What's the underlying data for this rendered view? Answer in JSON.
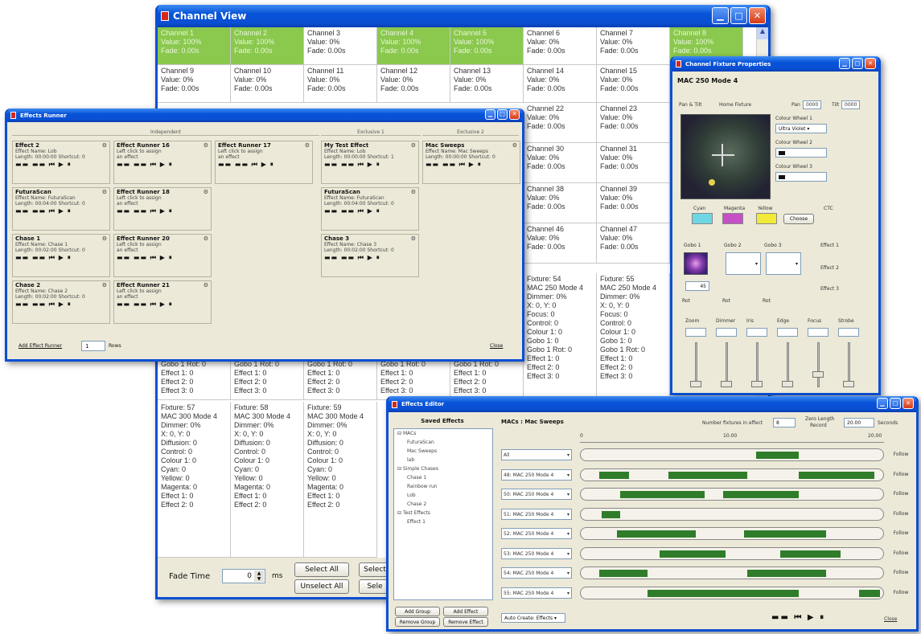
{
  "channel_view": {
    "title": "Channel View",
    "rows": [
      [
        {
          "l1": "Channel 1",
          "l2": "Value: 100%",
          "l3": "Fade: 0.00s",
          "on": true
        },
        {
          "l1": "Channel 2",
          "l2": "Value: 100%",
          "l3": "Fade: 0.00s",
          "on": true
        },
        {
          "l1": "Channel 3",
          "l2": "Value: 0%",
          "l3": "Fade: 0.00s",
          "on": false
        },
        {
          "l1": "Channel 4",
          "l2": "Value: 100%",
          "l3": "Fade: 0.00s",
          "on": true
        },
        {
          "l1": "Channel 5",
          "l2": "Value: 100%",
          "l3": "Fade: 0.00s",
          "on": true
        },
        {
          "l1": "Channel 6",
          "l2": "Value: 0%",
          "l3": "Fade: 0.00s",
          "on": false
        },
        {
          "l1": "Channel 7",
          "l2": "Value: 0%",
          "l3": "Fade: 0.00s",
          "on": false
        },
        {
          "l1": "Channel 8",
          "l2": "Value: 100%",
          "l3": "Fade: 0.00s",
          "on": true
        }
      ],
      [
        {
          "l1": "Channel 9",
          "l2": "Value: 0%",
          "l3": "Fade: 0.00s",
          "on": false
        },
        {
          "l1": "Channel 10",
          "l2": "Value: 0%",
          "l3": "Fade: 0.00s",
          "on": false
        },
        {
          "l1": "Channel 11",
          "l2": "Value: 0%",
          "l3": "Fade: 0.00s",
          "on": false
        },
        {
          "l1": "Channel 12",
          "l2": "Value: 0%",
          "l3": "Fade: 0.00s",
          "on": false
        },
        {
          "l1": "Channel 13",
          "l2": "Value: 0%",
          "l3": "Fade: 0.00s",
          "on": false
        },
        {
          "l1": "Channel 14",
          "l2": "Value: 0%",
          "l3": "Fade: 0.00s",
          "on": false
        },
        {
          "l1": "Channel 15",
          "l2": "Value: 0%",
          "l3": "Fade: 0.00s",
          "on": false
        }
      ]
    ],
    "right_cells": [
      {
        "l1": "Channel 22",
        "l2": "Value: 0%",
        "l3": "Fade: 0.00s"
      },
      {
        "l1": "Channel 23",
        "l2": "Value: 0%",
        "l3": "Fade: 0.00s"
      },
      {
        "l1": "Channel 30",
        "l2": "Value: 0%",
        "l3": "Fade: 0.00s"
      },
      {
        "l1": "Channel 31",
        "l2": "Value: 0%",
        "l3": "Fade: 0.00s"
      },
      {
        "l1": "Channel 38",
        "l2": "Value: 0%",
        "l3": "Fade: 0.00s"
      },
      {
        "l1": "Channel 39",
        "l2": "Value: 0%",
        "l3": "Fade: 0.00s"
      },
      {
        "l1": "Channel 46",
        "l2": "Value: 0%",
        "l3": "Fade: 0.00s"
      },
      {
        "l1": "Channel 47",
        "l2": "Value: 0%",
        "l3": "Fade: 0.00s"
      }
    ],
    "fixture_cells": [
      {
        "text": "Fixture: 54\nMAC 250 Mode 4\nDimmer: 0%\nX: 0, Y: 0\nFocus: 0\nControl: 0\nColour 1: 0\nGobo 1: 0\nGobo 1 Rot: 0\nEffect 1: 0\nEffect 2: 0\nEffect 3: 0"
      },
      {
        "text": "Fixture: 55\nMAC 250 Mode 4\nDimmer: 0%\nX: 0, Y: 0\nFocus: 0\nControl: 0\nColour 1: 0\nGobo 1: 0\nGobo 1 Rot: 0\nEffect 1: 0\nEffect 2: 0\nEffect 3: 0"
      }
    ],
    "effect_cells": [
      {
        "text": "Gobo 1 Rot: 0\nEffect 1: 0\nEffect 2: 0\nEffect 3: 0"
      },
      {
        "text": "Gobo 1 Rot: 0\nEffect 1: 0\nEffect 2: 0\nEffect 3: 0"
      },
      {
        "text": "Gobo 1 Rot: 0\nEffect 1: 0\nEffect 2: 0\nEffect 3: 0"
      },
      {
        "text": "Gobo 1 Rot: 0\nEffect 1: 0\nEffect 2: 0\nEffect 3: 0"
      },
      {
        "text": "Gobo 1 Rot: 0\nEffect 1: 0\nEffect 2: 0\nEffect 3: 0"
      }
    ],
    "mac300_cells": [
      {
        "text": "Fixture: 57\nMAC 300 Mode 4\nDimmer: 0%\nX: 0, Y: 0\nDiffusion: 0\nControl: 0\nColour 1: 0\nCyan: 0\nYellow: 0\nMagenta: 0\nEffect 1: 0\nEffect 2: 0"
      },
      {
        "text": "Fixture: 58\nMAC 300 Mode 4\nDimmer: 0%\nX: 0, Y: 0\nDiffusion: 0\nControl: 0\nColour 1: 0\nCyan: 0\nYellow: 0\nMagenta: 0\nEffect 1: 0\nEffect 2: 0"
      },
      {
        "text": "Fixture: 59\nMAC 300 Mode 4\nDimmer: 0%\nX: 0, Y: 0\nDiffusion: 0\nControl: 0\nColour 1: 0\nCyan: 0\nYellow: 0\nMagenta: 0\nEffect 1: 0\nEffect 2: 0"
      }
    ],
    "fade_label": "Fade Time",
    "fade_value": "0",
    "fade_unit": "ms",
    "select_all": "Select All",
    "unselect_all": "Unselect All",
    "select_clip": "Select",
    "select_clip2": "Sele"
  },
  "effects_runner": {
    "title": "Effects Runner",
    "headers": [
      "Independent",
      "Exclusive 1",
      "Exclusive 2"
    ],
    "effects": [
      {
        "name": "Effect 2",
        "d1": "Effect Name: Lob",
        "d2": "Length: 00:00:00 Shortcut: 0"
      },
      {
        "name": "Effect Runner 16",
        "d1": "Left click to assign",
        "d2": "an effect"
      },
      {
        "name": "Effect Runner 17",
        "d1": "Left click to assign",
        "d2": "an effect"
      },
      {
        "name": "My Test Effect",
        "d1": "Effect Name: Lob",
        "d2": "Length: 00:00:00 Shortcut: 1"
      },
      {
        "name": "Mac Sweeps",
        "d1": "Effect Name: Mac Sweeps",
        "d2": "Length: 00:00:00 Shortcut: 0"
      },
      {
        "name": "FuturaScan",
        "d1": "Effect Name: FuturaScan",
        "d2": "Length: 00:04:00 Shortcut: 0"
      },
      {
        "name": "Effect Runner 18",
        "d1": "Left click to assign",
        "d2": "an effect"
      },
      {
        "name": "FuturaScan",
        "d1": "Effect Name: FuturaScan",
        "d2": "Length: 00:04:00 Shortcut: 0"
      },
      {
        "name": "Chase 1",
        "d1": "Effect Name: Chase 1",
        "d2": "Length: 00:02:00 Shortcut: 0"
      },
      {
        "name": "Effect Runner 20",
        "d1": "Left click to assign",
        "d2": "an effect"
      },
      {
        "name": "Chase 3",
        "d1": "Effect Name: Chase 3",
        "d2": "Length: 00:02:00 Shortcut: 0"
      },
      {
        "name": "Chase 2",
        "d1": "Effect Name: Chase 2",
        "d2": "Length: 00:02:00 Shortcut: 0"
      },
      {
        "name": "Effect Runner 21",
        "d1": "Left click to assign",
        "d2": "an effect"
      }
    ],
    "controls_text": "▬▬ ▬▬  ⏮  ▶  ⏸",
    "add_label": "Add Effect Runner",
    "rows_value": "1",
    "rows_label": "Rows",
    "close": "Close"
  },
  "fixture_props": {
    "title": "Channel Fixture Properties",
    "model": "MAC 250 Mode 4",
    "pantilt_label": "Pan & Tilt",
    "home_label": "Home Fixture",
    "pan_label": "Pan",
    "pan_value": "0000",
    "tilt_label": "Tilt",
    "tilt_value": "0000",
    "colour_wheel_1": "Colour Wheel 1",
    "colour_wheel_2": "Colour Wheel 2",
    "colour_wheel_3": "Colour Wheel 3",
    "wheel1_value": "Ultra Violet",
    "cyan": "Cyan",
    "magenta": "Magenta",
    "yellow": "Yellow",
    "ctc": "CTC",
    "choose": "Choose",
    "gobo_1": "Gobo 1",
    "gobo_2": "Gobo 2",
    "gobo_3": "Gobo 3",
    "effect_1": "Effect 1",
    "effect_2": "Effect 2",
    "effect_3": "Effect 3",
    "rot": "Rot",
    "gobo_value": "45",
    "sliders": [
      "Zoom",
      "Dimmer",
      "Iris",
      "Edge",
      "Focus",
      "Strobe"
    ],
    "colors": {
      "cyan": "#6fd6e4",
      "magenta": "#c64fc6",
      "yellow": "#f2ea38"
    }
  },
  "effects_editor": {
    "title": "Effects Editor",
    "saved_header": "Saved Effects",
    "effect_title": "MACs : Mac Sweeps",
    "num_fixtures_label": "Number fixtures in effect",
    "num_fixtures_value": "8",
    "zero_length": "Zero Length",
    "record": "Record",
    "seconds_value": "20.00",
    "seconds_label": "Seconds",
    "ruler": [
      "0",
      "10.00",
      "20.00"
    ],
    "tree": [
      "MACs",
      "FuturaScan",
      "Mac Sweeps",
      "lab",
      "Simple Chases",
      "Chase 1",
      "Rainbow run",
      "Lob",
      "Chase 2",
      "Test Effects",
      "Effect 1"
    ],
    "tracks": [
      {
        "label": "All",
        "bars": [
          [
            0.58,
            0.72
          ]
        ]
      },
      {
        "label": "48: MAC 250 Mode 4",
        "bars": [
          [
            0.06,
            0.16
          ],
          [
            0.29,
            0.55
          ],
          [
            0.72,
            0.97
          ]
        ]
      },
      {
        "label": "50: MAC 250 Mode 4",
        "bars": [
          [
            0.13,
            0.41
          ],
          [
            0.47,
            0.72
          ]
        ]
      },
      {
        "label": "51: MAC 250 Mode 4",
        "bars": [
          [
            0.07,
            0.13
          ]
        ]
      },
      {
        "label": "52: MAC 250 Mode 4",
        "bars": [
          [
            0.12,
            0.38
          ],
          [
            0.54,
            0.81
          ]
        ]
      },
      {
        "label": "53: MAC 250 Mode 4",
        "bars": [
          [
            0.26,
            0.48
          ],
          [
            0.66,
            0.86
          ]
        ]
      },
      {
        "label": "54: MAC 250 Mode 4",
        "bars": [
          [
            0.06,
            0.22
          ],
          [
            0.55,
            0.81
          ]
        ]
      },
      {
        "label": "55: MAC 250 Mode 4",
        "bars": [
          [
            0.22,
            0.41
          ],
          [
            0.41,
            0.72
          ],
          [
            0.92,
            0.99
          ]
        ]
      }
    ],
    "follow_label": "Follow",
    "add_group": "Add Group",
    "remove_group": "Remove Group",
    "add_effect": "Add Effect",
    "remove_effect": "Remove Effect",
    "auto_create": "Auto Create: Effects",
    "close": "Close",
    "bar_color": "#2f7d2a"
  }
}
